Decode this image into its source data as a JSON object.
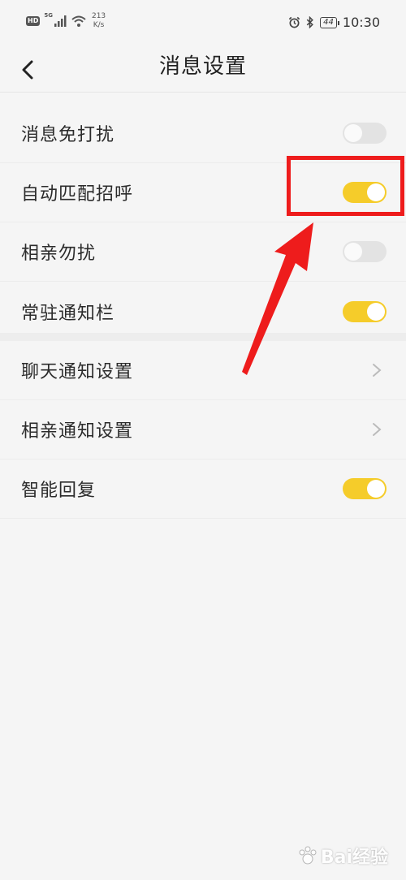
{
  "status_bar": {
    "hd": "HD",
    "signal_tag": "5G",
    "speed_value": "213",
    "speed_unit": "K/s",
    "battery": "44",
    "time": "10:30"
  },
  "header": {
    "title": "消息设置"
  },
  "settings": [
    {
      "label": "消息免打扰",
      "control": "toggle",
      "on": false
    },
    {
      "label": "自动匹配招呼",
      "control": "toggle",
      "on": true
    },
    {
      "label": "相亲勿扰",
      "control": "toggle",
      "on": false
    },
    {
      "label": "常驻通知栏",
      "control": "toggle",
      "on": true
    },
    {
      "label": "聊天通知设置",
      "control": "chevron"
    },
    {
      "label": "相亲通知设置",
      "control": "chevron"
    },
    {
      "label": "智能回复",
      "control": "toggle",
      "on": true
    }
  ],
  "colors": {
    "toggle_on": "#f5cc2a",
    "toggle_off": "#e3e3e3",
    "annotation": "#ee1c1c"
  },
  "watermark": {
    "text": "Bai经验"
  }
}
